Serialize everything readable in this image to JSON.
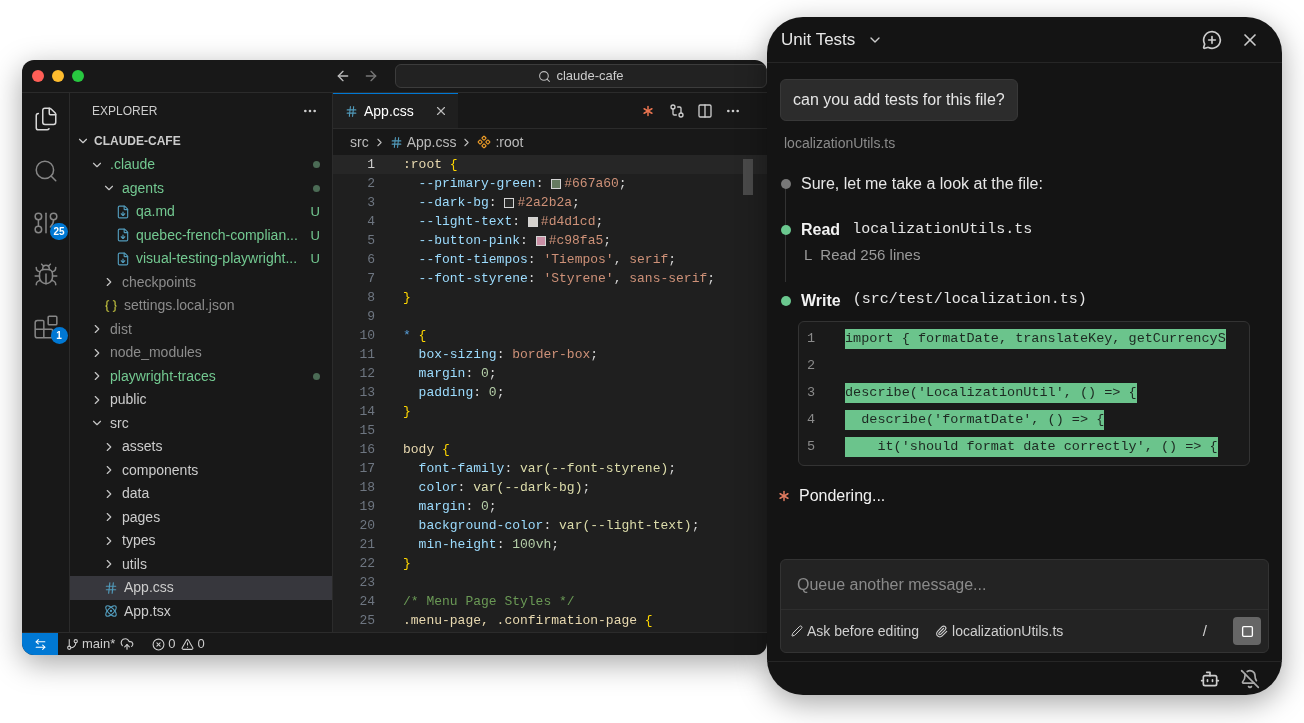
{
  "window": {
    "search": "claude-cafe"
  },
  "activity_bar": [
    {
      "kind": "files",
      "selected": true
    },
    {
      "kind": "search",
      "selected": false
    },
    {
      "kind": "source-control",
      "selected": false,
      "badge": "25"
    },
    {
      "kind": "run",
      "selected": false
    },
    {
      "kind": "extensions",
      "selected": false,
      "badge": "1"
    }
  ],
  "explorer": {
    "title": "EXPLORER",
    "root": "CLAUDE-CAFE",
    "tree": [
      {
        "name": ".claude",
        "kind": "folder",
        "expanded": true,
        "changed": true,
        "dot": true,
        "selected": false,
        "children": [
          {
            "name": "agents",
            "kind": "folder",
            "expanded": true,
            "changed": true,
            "dot": true,
            "selected": false,
            "children": [
              {
                "name": "qa.md",
                "kind": "md",
                "changed": true,
                "badge": "U",
                "selected": false
              },
              {
                "name": "quebec-french-complian...",
                "kind": "md",
                "changed": true,
                "badge": "U",
                "selected": false
              },
              {
                "name": "visual-testing-playwright...",
                "kind": "md",
                "changed": true,
                "badge": "U",
                "selected": false
              }
            ]
          },
          {
            "name": "checkpoints",
            "kind": "folder",
            "expanded": false,
            "ignored": true,
            "selected": false
          },
          {
            "name": "settings.local.json",
            "kind": "json",
            "ignored": true,
            "selected": false
          }
        ]
      },
      {
        "name": "dist",
        "kind": "folder",
        "expanded": false,
        "ignored": true,
        "selected": false
      },
      {
        "name": "node_modules",
        "kind": "folder",
        "expanded": false,
        "ignored": true,
        "selected": false
      },
      {
        "name": "playwright-traces",
        "kind": "folder",
        "expanded": false,
        "changed": true,
        "dot": true,
        "selected": false
      },
      {
        "name": "public",
        "kind": "folder",
        "expanded": false,
        "selected": false
      },
      {
        "name": "src",
        "kind": "folder",
        "expanded": true,
        "selected": false,
        "children": [
          {
            "name": "assets",
            "kind": "folder",
            "expanded": false,
            "selected": false
          },
          {
            "name": "components",
            "kind": "folder",
            "expanded": false,
            "selected": false
          },
          {
            "name": "data",
            "kind": "folder",
            "expanded": false,
            "selected": false
          },
          {
            "name": "pages",
            "kind": "folder",
            "expanded": false,
            "selected": false
          },
          {
            "name": "types",
            "kind": "folder",
            "expanded": false,
            "selected": false
          },
          {
            "name": "utils",
            "kind": "folder",
            "expanded": false,
            "selected": false
          },
          {
            "name": "App.css",
            "kind": "css",
            "selected": true
          },
          {
            "name": "App.tsx",
            "kind": "react",
            "selected": false
          }
        ]
      }
    ]
  },
  "editor": {
    "tab": {
      "label": "App.css",
      "selected": true
    },
    "breadcrumb": [
      "src",
      "App.css",
      ":root"
    ],
    "lines": [
      {
        "number": "1",
        "current": true,
        "tokens": [
          {
            "kind": "sel",
            "text": ":root "
          },
          {
            "kind": "brace",
            "text": "{"
          }
        ]
      },
      {
        "number": "2",
        "current": false,
        "tokens": [
          {
            "kind": "prop",
            "text": "  --primary-green"
          },
          {
            "kind": "punct",
            "text": ": "
          },
          {
            "kind": "swatch",
            "color": "#667a60"
          },
          {
            "kind": "val",
            "text": "#667a60"
          },
          {
            "kind": "punct",
            "text": ";"
          }
        ]
      },
      {
        "number": "3",
        "current": false,
        "tokens": [
          {
            "kind": "prop",
            "text": "  --dark-bg"
          },
          {
            "kind": "punct",
            "text": ": "
          },
          {
            "kind": "swatch",
            "color": "#2a2b2a"
          },
          {
            "kind": "val",
            "text": "#2a2b2a"
          },
          {
            "kind": "punct",
            "text": ";"
          }
        ]
      },
      {
        "number": "4",
        "current": false,
        "tokens": [
          {
            "kind": "prop",
            "text": "  --light-text"
          },
          {
            "kind": "punct",
            "text": ": "
          },
          {
            "kind": "swatch",
            "color": "#d4d1cd"
          },
          {
            "kind": "val",
            "text": "#d4d1cd"
          },
          {
            "kind": "punct",
            "text": ";"
          }
        ]
      },
      {
        "number": "5",
        "current": false,
        "tokens": [
          {
            "kind": "prop",
            "text": "  --button-pink"
          },
          {
            "kind": "punct",
            "text": ": "
          },
          {
            "kind": "swatch",
            "color": "#c98fa5"
          },
          {
            "kind": "val",
            "text": "#c98fa5"
          },
          {
            "kind": "punct",
            "text": ";"
          }
        ]
      },
      {
        "number": "6",
        "current": false,
        "tokens": [
          {
            "kind": "prop",
            "text": "  --font-tiempos"
          },
          {
            "kind": "punct",
            "text": ": "
          },
          {
            "kind": "val",
            "text": "'Tiempos'"
          },
          {
            "kind": "punct",
            "text": ", "
          },
          {
            "kind": "val",
            "text": "serif"
          },
          {
            "kind": "punct",
            "text": ";"
          }
        ]
      },
      {
        "number": "7",
        "current": false,
        "tokens": [
          {
            "kind": "prop",
            "text": "  --font-styrene"
          },
          {
            "kind": "punct",
            "text": ": "
          },
          {
            "kind": "val",
            "text": "'Styrene'"
          },
          {
            "kind": "punct",
            "text": ", "
          },
          {
            "kind": "val",
            "text": "sans-serif"
          },
          {
            "kind": "punct",
            "text": ";"
          }
        ]
      },
      {
        "number": "8",
        "current": false,
        "tokens": [
          {
            "kind": "brace",
            "text": "}"
          }
        ]
      },
      {
        "number": "9",
        "current": false
      },
      {
        "number": "10",
        "current": false,
        "tokens": [
          {
            "kind": "star",
            "text": "* "
          },
          {
            "kind": "brace",
            "text": "{"
          }
        ]
      },
      {
        "number": "11",
        "current": false,
        "tokens": [
          {
            "kind": "prop",
            "text": "  box-sizing"
          },
          {
            "kind": "punct",
            "text": ": "
          },
          {
            "kind": "val",
            "text": "border-box"
          },
          {
            "kind": "punct",
            "text": ";"
          }
        ]
      },
      {
        "number": "12",
        "current": false,
        "tokens": [
          {
            "kind": "prop",
            "text": "  margin"
          },
          {
            "kind": "punct",
            "text": ": "
          },
          {
            "kind": "num",
            "text": "0"
          },
          {
            "kind": "punct",
            "text": ";"
          }
        ]
      },
      {
        "number": "13",
        "current": false,
        "tokens": [
          {
            "kind": "prop",
            "text": "  padding"
          },
          {
            "kind": "punct",
            "text": ": "
          },
          {
            "kind": "num",
            "text": "0"
          },
          {
            "kind": "punct",
            "text": ";"
          }
        ]
      },
      {
        "number": "14",
        "current": false,
        "tokens": [
          {
            "kind": "brace",
            "text": "}"
          }
        ]
      },
      {
        "number": "15",
        "current": false
      },
      {
        "number": "16",
        "current": false,
        "tokens": [
          {
            "kind": "sel",
            "text": "body "
          },
          {
            "kind": "brace",
            "text": "{"
          }
        ]
      },
      {
        "number": "17",
        "current": false,
        "tokens": [
          {
            "kind": "prop",
            "text": "  font-family"
          },
          {
            "kind": "punct",
            "text": ": "
          },
          {
            "kind": "fn",
            "text": "var(--font-styrene)"
          },
          {
            "kind": "punct",
            "text": ";"
          }
        ]
      },
      {
        "number": "18",
        "current": false,
        "tokens": [
          {
            "kind": "prop",
            "text": "  color"
          },
          {
            "kind": "punct",
            "text": ": "
          },
          {
            "kind": "fn",
            "text": "var(--dark-bg)"
          },
          {
            "kind": "punct",
            "text": ";"
          }
        ]
      },
      {
        "number": "19",
        "current": false,
        "tokens": [
          {
            "kind": "prop",
            "text": "  margin"
          },
          {
            "kind": "punct",
            "text": ": "
          },
          {
            "kind": "num",
            "text": "0"
          },
          {
            "kind": "punct",
            "text": ";"
          }
        ]
      },
      {
        "number": "20",
        "current": false,
        "tokens": [
          {
            "kind": "prop",
            "text": "  background-color"
          },
          {
            "kind": "punct",
            "text": ": "
          },
          {
            "kind": "fn",
            "text": "var(--light-text)"
          },
          {
            "kind": "punct",
            "text": ";"
          }
        ]
      },
      {
        "number": "21",
        "current": false,
        "tokens": [
          {
            "kind": "prop",
            "text": "  min-height"
          },
          {
            "kind": "punct",
            "text": ": "
          },
          {
            "kind": "num",
            "text": "100vh"
          },
          {
            "kind": "punct",
            "text": ";"
          }
        ]
      },
      {
        "number": "22",
        "current": false,
        "tokens": [
          {
            "kind": "brace",
            "text": "}"
          }
        ]
      },
      {
        "number": "23",
        "current": false
      },
      {
        "number": "24",
        "current": false,
        "tokens": [
          {
            "kind": "comment",
            "text": "/* Menu Page Styles */"
          }
        ]
      },
      {
        "number": "25",
        "current": false,
        "tokens": [
          {
            "kind": "sel",
            "text": ".menu-page, .confirmation-page "
          },
          {
            "kind": "brace",
            "text": "{"
          }
        ]
      }
    ]
  },
  "status_bar": {
    "branch": "main*",
    "errors": "0",
    "warnings": "0"
  },
  "chat": {
    "title": "Unit Tests",
    "message": "can you add tests for this file?",
    "attachment": "localizationUtils.ts",
    "steps": [
      {
        "kind": "text",
        "text": "Sure, let me take a look at the file:"
      },
      {
        "kind": "tool",
        "name": "Read",
        "arg": "localizationUtils.ts",
        "result_prefix": "L",
        "result": "Read 256 lines"
      },
      {
        "kind": "tool",
        "name": "Write",
        "arg": "(src/test/localization.ts)",
        "code": [
          {
            "number": "1",
            "text": "import { formatDate, translateKey, getCurrencyS"
          },
          {
            "number": "2"
          },
          {
            "number": "3",
            "text": "describe('LocalizationUtil', () => {"
          },
          {
            "number": "4",
            "text": "  describe('formatDate', () => {"
          },
          {
            "number": "5",
            "text": "    it('should format date correctly', () => {"
          }
        ]
      }
    ],
    "status": "Pondering...",
    "input": {
      "placeholder": "Queue another message..."
    },
    "mode": "Ask before editing",
    "context_file": "localizationUtils.ts",
    "slash": "/"
  }
}
